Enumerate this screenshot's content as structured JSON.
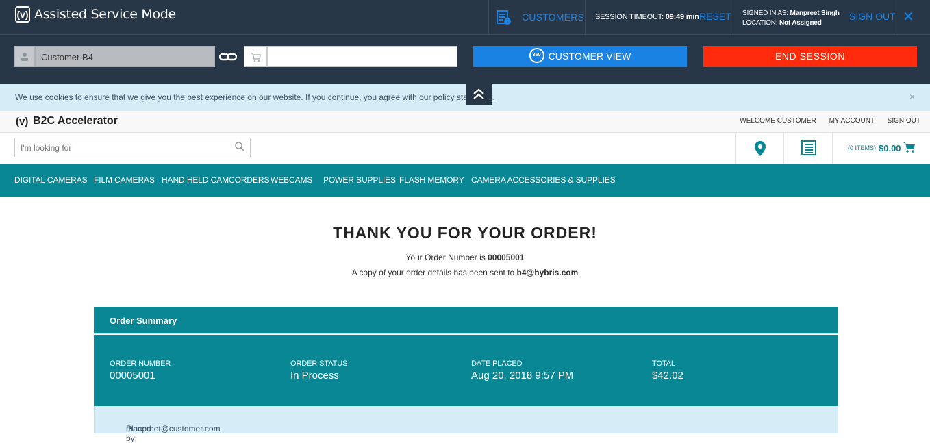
{
  "asm": {
    "title": "Assisted Service Mode",
    "logo_glyph": "(v)",
    "customers_label": "CUSTOMERS",
    "timeout_label": "SESSION TIMEOUT:",
    "timeout_value": "09:49 min",
    "reset_label": "RESET",
    "signed_in_label": "SIGNED IN AS:",
    "signed_in_value": "Manpreet Singh",
    "location_label": "LOCATION:",
    "location_value": "Not Assigned",
    "sign_out_label": "SIGN OUT",
    "close_glyph": "✕",
    "customer_value": "Customer B4",
    "cart_value": "",
    "customer_view_label": "CUSTOMER VIEW",
    "customer_view_icon_text": "360",
    "end_session_label": "END SESSION",
    "colors": {
      "bar": "#283748",
      "accent": "#1a82e2",
      "danger": "#ff2b0c"
    }
  },
  "cookie": {
    "text": "We use cookies to ensure that we give you the best experience on our website. If you continue, you agree with our policy statement.",
    "close_glyph": "×"
  },
  "site": {
    "logo_glyph": "(v)",
    "brand": "B2C Accelerator",
    "links": [
      "WELCOME CUSTOMER",
      "MY ACCOUNT",
      "SIGN OUT"
    ],
    "search_placeholder": "I'm looking for",
    "cart_items": "(0 ITEMS)",
    "cart_total": "$0.00"
  },
  "nav": {
    "items": [
      "DIGITAL CAMERAS",
      "FILM CAMERAS",
      "HAND HELD CAMCORDERS",
      "WEBCAMS",
      "POWER SUPPLIES",
      "FLASH MEMORY",
      "CAMERA ACCESSORIES & SUPPLIES"
    ]
  },
  "confirmation": {
    "heading": "THANK YOU FOR YOUR ORDER!",
    "order_number_prefix": "Your Order Number is ",
    "order_number": "00005001",
    "email_prefix": "A copy of your order details has been sent to ",
    "email": "b4@hybris.com"
  },
  "summary": {
    "title": "Order Summary",
    "columns": [
      {
        "label": "ORDER NUMBER",
        "value": "00005001"
      },
      {
        "label": "ORDER STATUS",
        "value": "In Process"
      },
      {
        "label": "DATE PLACED",
        "value": "Aug 20, 2018 9:57 PM"
      },
      {
        "label": "TOTAL",
        "value": "$42.02"
      }
    ],
    "placed_by_label": "Placed by: ",
    "placed_by_value": "manpreet@customer.com",
    "colors": {
      "teal": "#0a8795",
      "light": "#d6ecf6"
    }
  }
}
